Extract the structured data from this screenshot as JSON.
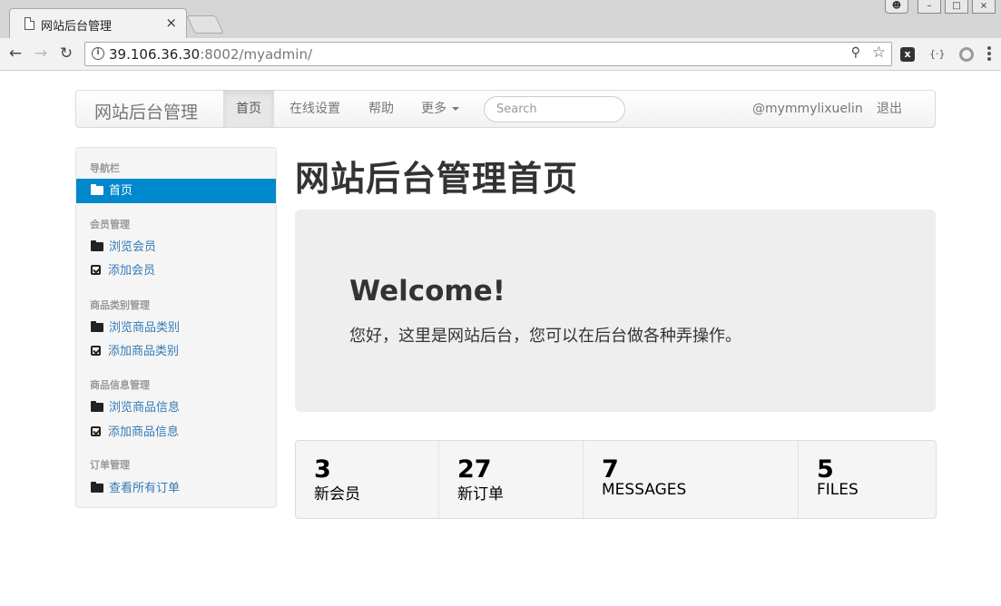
{
  "browser": {
    "tab_title": "网站后台管理",
    "tab_close": "×",
    "url_host": "39.106.36.30",
    "url_rest": ":8002/myadmin/"
  },
  "navbar": {
    "brand": "网站后台管理",
    "items": [
      "首页",
      "在线设置",
      "帮助",
      "更多"
    ],
    "search_placeholder": "Search",
    "user": "@mymmylixuelin",
    "logout": "退出"
  },
  "sidebar": {
    "sections": [
      {
        "header": "导航栏",
        "items": [
          {
            "label": "首页",
            "icon": "folder-open-icon",
            "active": true
          }
        ]
      },
      {
        "header": "会员管理",
        "items": [
          {
            "label": "浏览会员",
            "icon": "folder-open-icon"
          },
          {
            "label": "添加会员",
            "icon": "check-square-icon"
          }
        ]
      },
      {
        "header": "商品类别管理",
        "items": [
          {
            "label": "浏览商品类别",
            "icon": "folder-open-icon"
          },
          {
            "label": "添加商品类别",
            "icon": "check-square-icon"
          }
        ]
      },
      {
        "header": "商品信息管理",
        "items": [
          {
            "label": "浏览商品信息",
            "icon": "folder-open-icon"
          },
          {
            "label": "添加商品信息",
            "icon": "check-square-icon"
          }
        ]
      },
      {
        "header": "订单管理",
        "items": [
          {
            "label": "查看所有订单",
            "icon": "folder-open-icon"
          }
        ]
      }
    ]
  },
  "main": {
    "title": "网站后台管理首页",
    "welcome_title": "Welcome!",
    "welcome_text": "您好，这里是网站后台，您可以在后台做各种弄操作。"
  },
  "stats": [
    {
      "value": "3",
      "label": "新会员"
    },
    {
      "value": "27",
      "label": "新订单"
    },
    {
      "value": "7",
      "label": "MESSAGES"
    },
    {
      "value": "5",
      "label": "FILES"
    }
  ],
  "colors": {
    "accent": "#0088cc",
    "link": "#337ab7",
    "jumbotron": "#eeeeee"
  }
}
